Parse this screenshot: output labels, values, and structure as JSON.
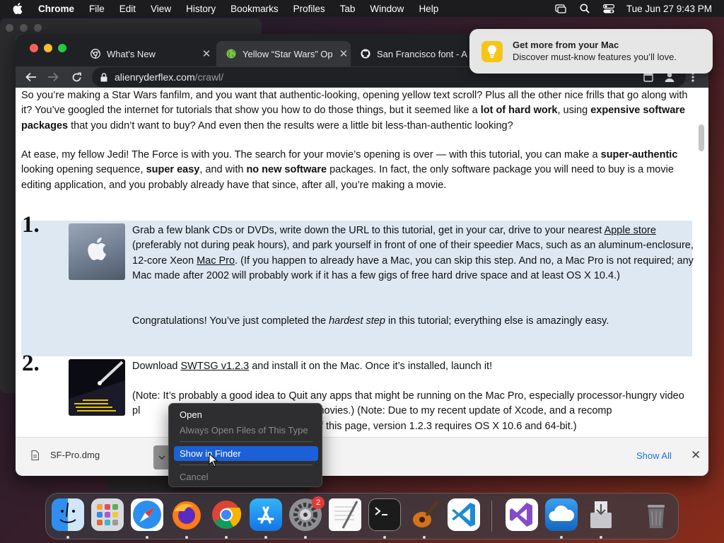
{
  "menubar": {
    "app_name": "Chrome",
    "items": [
      "File",
      "Edit",
      "View",
      "History",
      "Bookmarks",
      "Profiles",
      "Tab",
      "Window",
      "Help"
    ],
    "clock": "Tue Jun 27  9:43 PM"
  },
  "tabs": [
    {
      "title": "What's New",
      "favicon": "chrome-icon",
      "active": false
    },
    {
      "title": "Yellow “Star Wars” Op",
      "favicon": "globe-icon",
      "active": true
    },
    {
      "title": "San Francisco font - A",
      "favicon": "github-icon",
      "active": false
    }
  ],
  "address_bar": {
    "host": "alienryderflex.com",
    "path": "/crawl/"
  },
  "notification": {
    "title": "Get more from your Mac",
    "body": "Discover must-know features you’ll love."
  },
  "page": {
    "intro1": [
      {
        "t": "So you’re making a Star Wars fanfilm, and you want that authentic-looking, opening yellow text scroll?  Plus all the other nice frills that go along with it? You’ve googled the internet for tutorials that show you how to do those things, but it seemed like a "
      },
      {
        "t": "lot of hard work",
        "b": true
      },
      {
        "t": ", using "
      },
      {
        "t": "expensive software packages",
        "b": true
      },
      {
        "t": " that you didn’t want to buy? And even then the results were a little bit less-than-authentic looking?"
      }
    ],
    "intro2": [
      {
        "t": "At ease, my fellow Jedi! The Force is with you. The search for your movie’s opening is over — with this tutorial, you can make a "
      },
      {
        "t": "super-authentic",
        "b": true
      },
      {
        "t": " looking opening sequence, "
      },
      {
        "t": "super easy",
        "b": true
      },
      {
        "t": ", and with "
      },
      {
        "t": "no new software",
        "b": true
      },
      {
        "t": " packages. In fact, the only software package you will need to buy is a movie editing application, and you probably already have that since, after all, you’re making a movie."
      }
    ],
    "step1_num": "1.",
    "step1_p1": [
      {
        "t": "Grab a few blank CDs or DVDs, write down the URL to this tutorial, get in your car, drive to your nearest "
      },
      {
        "t": "Apple store",
        "u": true
      },
      {
        "t": " (preferably not during peak hours), and park yourself in front of one of their speedier Macs, such as an aluminum-enclosure, 12-core Xeon "
      },
      {
        "t": "Mac Pro",
        "u": true
      },
      {
        "t": ". (If you happen to already have a Mac, you can skip this step. And no, a Mac Pro is not required; any Mac made after 2002 will probably work if it has a few gigs of free hard drive space and at least OS X 10.4.)"
      }
    ],
    "step1_p2": [
      {
        "t": "Congratulations! You’ve just completed the "
      },
      {
        "t": "hardest step",
        "i": true
      },
      {
        "t": " in this tutorial; everything else is amazingly easy."
      }
    ],
    "step2_num": "2.",
    "step2_p1": [
      {
        "t": "Download "
      },
      {
        "t": "SWTSG v1.2.3",
        "u": true
      },
      {
        "t": " and install it on the Mac. Once it’s installed, launch it!"
      }
    ],
    "step2_p2": [
      {
        "t": "(Note: It’s probably a good idea to Quit any apps that might be running on the Mac Pro, especially processor-hungry video pl"
      },
      {
        "t": "                                    ",
        "gap": true
      },
      {
        "t": "sive, HD, demo movies.) (Note: Due to my recent update of Xcode, and a recomp"
      },
      {
        "t": "                                         ",
        "gap": true
      },
      {
        "t": " at the bottom of this page, version 1.2.3 requires OS X 10.6 and 64-bit.)"
      }
    ]
  },
  "download_bar": {
    "filename": "SF-Pro.dmg",
    "show_all": "Show All"
  },
  "context_menu": {
    "items": [
      {
        "label": "Open",
        "enabled": true,
        "highlighted": false
      },
      {
        "label": "Always Open Files of This Type",
        "enabled": false,
        "highlighted": false
      },
      {
        "label": "Show in Finder",
        "enabled": true,
        "highlighted": true
      },
      {
        "label": "Cancel",
        "enabled": false,
        "highlighted": false
      }
    ]
  },
  "dock": {
    "items": [
      "finder",
      "launchpad",
      "safari",
      "firefox",
      "chrome",
      "app-store",
      "system-preferences",
      "textedit",
      "terminal",
      "garageband",
      "vscode",
      "visual-studio",
      "onedrive",
      "installer",
      "trash"
    ],
    "settings_badge": "2"
  },
  "colors": {
    "selection_blue": "#1d5fd6",
    "link_blue": "#1a73e8",
    "step_highlight": "#dde8f3"
  }
}
